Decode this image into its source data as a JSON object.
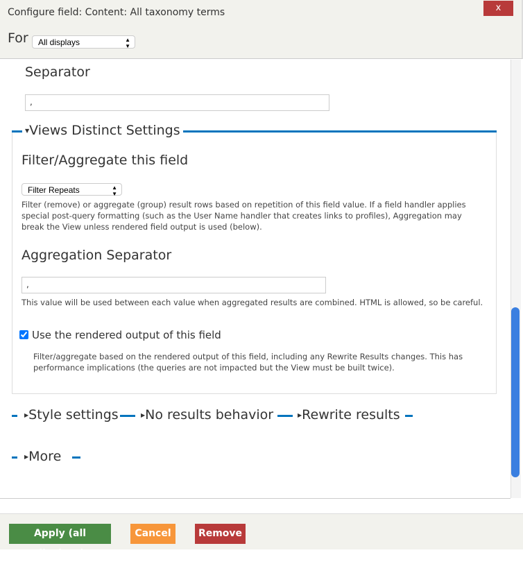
{
  "dialog": {
    "title": "Configure field: Content: All taxonomy terms",
    "close_label": "x"
  },
  "for": {
    "label": "For",
    "value": "All displays"
  },
  "separator": {
    "label": "Separator",
    "value": ","
  },
  "distinct": {
    "legend": "Views Distinct Settings",
    "filter_label": "Filter/Aggregate this field",
    "filter_value": "Filter Repeats",
    "filter_desc": "Filter (remove) or aggregate (group) result rows based on repetition of this field value. If a field handler applies special post-query formatting (such as the User Name handler that creates links to profiles), Aggregation may break the View unless rendered field output is used (below).",
    "agg_label": "Aggregation Separator",
    "agg_value": ",",
    "agg_desc": "This value will be used between each value when aggregated results are combined. HTML is allowed, so be careful.",
    "rendered_label": "Use the rendered output of this field",
    "rendered_checked": true,
    "rendered_desc": "Filter/aggregate based on the rendered output of this field, including any Rewrite Results changes. This has performance implications (the queries are not impacted but the View must be built twice)."
  },
  "sections": [
    "Style settings",
    "No results behavior",
    "Rewrite results",
    "More"
  ],
  "buttons": {
    "apply": "Apply (all displays)",
    "cancel": "Cancel",
    "remove": "Remove"
  },
  "colors": {
    "accent": "#0074bd",
    "apply": "#4a8c45",
    "cancel": "#f7963a",
    "remove": "#b83a3a"
  }
}
